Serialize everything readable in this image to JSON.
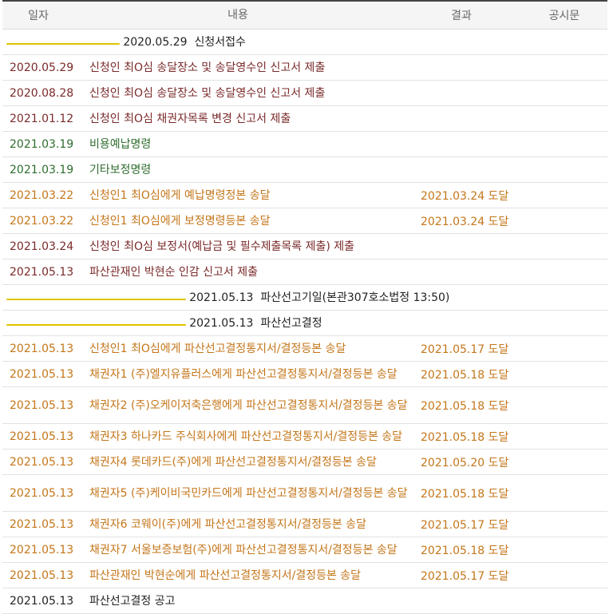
{
  "columns": {
    "date": "일자",
    "content": "내용",
    "result": "결과",
    "notice": "공시문"
  },
  "colors": {
    "black": "#222222",
    "maroon": "#7a2a2a",
    "green": "#2f6d2f",
    "orange": "#c4761a",
    "highlight": "#ffff55"
  },
  "rows": [
    {
      "date": "2020.05.29",
      "content": "신청서접수",
      "result": "",
      "kind": "black",
      "highlight": true
    },
    {
      "date": "2020.05.29",
      "content": "신청인 최O심 송달장소 및 송달영수인 신고서 제출",
      "result": "",
      "kind": "maroon"
    },
    {
      "date": "2020.08.28",
      "content": "신청인 최O심 송달장소 및 송달영수인 신고서 제출",
      "result": "",
      "kind": "maroon"
    },
    {
      "date": "2021.01.12",
      "content": "신청인 최O심 채권자목록 변경 신고서 제출",
      "result": "",
      "kind": "maroon"
    },
    {
      "date": "2021.03.19",
      "content": "비용예납명령",
      "result": "",
      "kind": "green"
    },
    {
      "date": "2021.03.19",
      "content": "기타보정명령",
      "result": "",
      "kind": "green"
    },
    {
      "date": "2021.03.22",
      "content": "신청인1 최O심에게 예납명령정본 송달",
      "result": "2021.03.24 도달",
      "kind": "orange"
    },
    {
      "date": "2021.03.22",
      "content": "신청인1 최O심에게 보정명령등본 송달",
      "result": "2021.03.24 도달",
      "kind": "orange"
    },
    {
      "date": "2021.03.24",
      "content": "신청인 최O심 보정서(예납금 및 필수제출목록 제출) 제출",
      "result": "",
      "kind": "maroon"
    },
    {
      "date": "2021.05.13",
      "content": "파산관재인 박현순 인감 신고서 제출",
      "result": "",
      "kind": "maroon"
    },
    {
      "date": "2021.05.13",
      "content": "파산선고기일(본관307호소법정 13:50)",
      "result": "",
      "kind": "black",
      "highlight": true
    },
    {
      "date": "2021.05.13",
      "content": "파산선고결정",
      "result": "",
      "kind": "black",
      "highlight": true
    },
    {
      "date": "2021.05.13",
      "content": "신청인1 최O심에게 파산선고결정통지서/결정등본 송달",
      "result": "2021.05.17 도달",
      "kind": "orange"
    },
    {
      "date": "2021.05.13",
      "content": "채권자1 (주)엘지유플러스에게 파산선고결정통지서/결정등본 송달",
      "result": "2021.05.18 도달",
      "kind": "orange"
    },
    {
      "date": "2021.05.13",
      "content": "채권자2 (주)오케이저축은행에게 파산선고결정통지서/결정등본 송달",
      "result": "2021.05.18 도달",
      "kind": "orange",
      "tall": true
    },
    {
      "date": "2021.05.13",
      "content": "채권자3 하나카드 주식회사에게 파산선고결정통지서/결정등본 송달",
      "result": "2021.05.18 도달",
      "kind": "orange"
    },
    {
      "date": "2021.05.13",
      "content": "채권자4 롯데카드(주)에게 파산선고결정통지서/결정등본 송달",
      "result": "2021.05.20 도달",
      "kind": "orange"
    },
    {
      "date": "2021.05.13",
      "content": "채권자5 (주)케이비국민카드에게 파산선고결정통지서/결정등본 송달",
      "result": "2021.05.18 도달",
      "kind": "orange",
      "tall": true
    },
    {
      "date": "2021.05.13",
      "content": "채권자6 코웨이(주)에게 파산선고결정통지서/결정등본 송달",
      "result": "2021.05.17 도달",
      "kind": "orange"
    },
    {
      "date": "2021.05.13",
      "content": "채권자7 서울보증보험(주)에게 파산선고결정통지서/결정등본 송달",
      "result": "2021.05.18 도달",
      "kind": "orange"
    },
    {
      "date": "2021.05.13",
      "content": "파산관재인 박현순에게 파산선고결정통지서/결정등본 송달",
      "result": "2021.05.17 도달",
      "kind": "orange"
    },
    {
      "date": "2021.05.13",
      "content": "파산선고결정 공고",
      "result": "",
      "kind": "black"
    }
  ]
}
